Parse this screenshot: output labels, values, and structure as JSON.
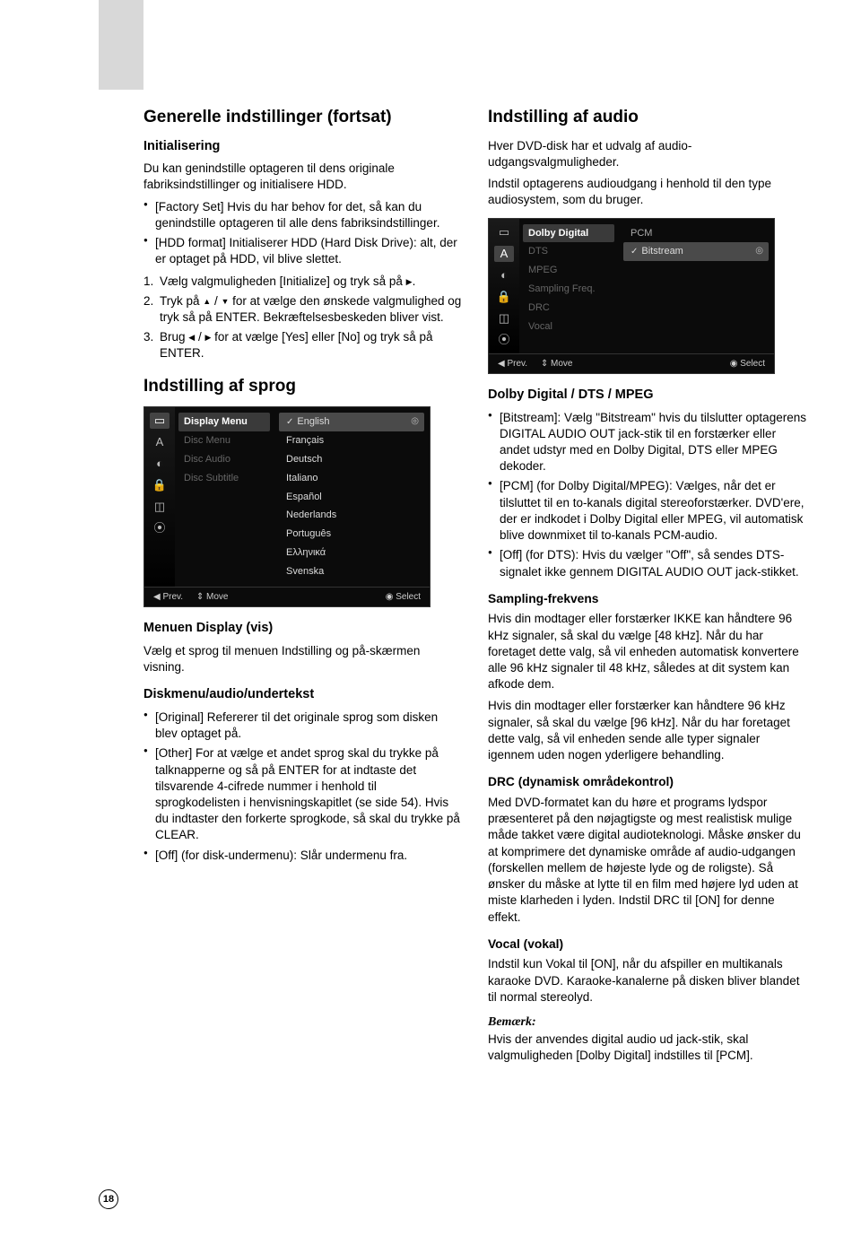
{
  "page_number": "18",
  "left": {
    "h1": "Generelle indstillinger (fortsat)",
    "init_h": "Initialisering",
    "init_p": "Du kan genindstille optageren til dens originale fabriksindstillinger og initialisere HDD.",
    "init_b1": "[Factory Set] Hvis du har behov for det, så kan du genindstille optageren til alle dens fabriksindstillinger.",
    "init_b2": "[HDD format] Initialiserer HDD (Hard Disk Drive): alt, der er optaget på HDD, vil blive slettet.",
    "s1_pre": "Vælg valgmuligheden [Initialize] og tryk så på ",
    "s2_pre": "Tryk på ",
    "s2_mid": " / ",
    "s2_post": " for at vælge den ønskede valgmulighed og tryk så på ENTER. Bekræftelsesbeskeden bliver vist.",
    "s3_pre": "Brug ",
    "s3_mid": " / ",
    "s3_post": " for at vælge [Yes] eller [No] og tryk så på ENTER.",
    "sprog_h1": "Indstilling af sprog",
    "menu1": {
      "middle": [
        "Display Menu",
        "Disc Menu",
        "Disc Audio",
        "Disc Subtitle"
      ],
      "options": [
        "English",
        "Français",
        "Deutsch",
        "Italiano",
        "Español",
        "Nederlands",
        "Português",
        "Ελληνικά",
        "Svenska"
      ],
      "footer_prev": "◀ Prev.",
      "footer_move": "⇕ Move",
      "footer_select": "◉ Select"
    },
    "display_h": "Menuen Display (vis)",
    "display_p": "Vælg et sprog til menuen Indstilling og på-skærmen visning.",
    "disk_h": "Diskmenu/audio/undertekst",
    "disk_b1": "[Original] Refererer til det originale sprog som disken blev optaget på.",
    "disk_b2": "[Other] For at vælge et andet sprog skal du trykke på talknapperne og så på ENTER for at indtaste det tilsvarende 4-cifrede nummer i henhold til sprogkodelisten i henvisningskapitlet (se side 54). Hvis du indtaster den forkerte sprogkode, så skal du trykke på CLEAR.",
    "disk_b3": "[Off] (for disk-undermenu): Slår undermenu fra."
  },
  "right": {
    "h1": "Indstilling af audio",
    "p1": "Hver DVD-disk har et udvalg af audio-udgangsvalgmuligheder.",
    "p2": "Indstil optagerens audioudgang i henhold til den type audiosystem, som du bruger.",
    "menu2": {
      "middle": [
        "Dolby Digital",
        "DTS",
        "MPEG",
        "Sampling Freq.",
        "DRC",
        "Vocal"
      ],
      "right_label": "PCM",
      "right_sel": "Bitstream",
      "footer_prev": "◀ Prev.",
      "footer_move": "⇕ Move",
      "footer_select": "◉ Select"
    },
    "dolby_h": "Dolby Digital / DTS / MPEG",
    "dolby_b1": "[Bitstream]: Vælg \"Bitstream\" hvis du tilslutter optagerens DIGITAL AUDIO OUT jack-stik til en forstærker eller andet udstyr med en Dolby Digital, DTS eller MPEG dekoder.",
    "dolby_b2": "[PCM] (for Dolby Digital/MPEG): Vælges, når det er tilsluttet til en to-kanals digital stereoforstærker. DVD'ere, der er indkodet i Dolby Digital eller MPEG, vil automatisk blive downmixet til to-kanals PCM-audio.",
    "dolby_b3": "[Off] (for DTS): Hvis du vælger \"Off\", så sendes DTS-signalet ikke gennem DIGITAL AUDIO OUT jack-stikket.",
    "samp_h": "Sampling-frekvens",
    "samp_p1": "Hvis din modtager eller forstærker IKKE kan håndtere 96 kHz signaler, så skal du vælge [48 kHz]. Når du har foretaget dette valg, så vil enheden automatisk konvertere alle 96 kHz signaler til 48 kHz, således at dit system kan afkode dem.",
    "samp_p2": "Hvis din modtager eller forstærker kan håndtere 96 kHz signaler, så skal du vælge [96 kHz]. Når du har foretaget dette valg, så vil enheden sende alle typer signaler igennem uden nogen yderligere behandling.",
    "drc_h": "DRC (dynamisk områdekontrol)",
    "drc_p": "Med DVD-formatet kan du høre et programs lydspor præsenteret på den nøjagtigste og mest realistisk mulige måde takket være digital audioteknologi. Måske ønsker du at komprimere det dynamiske område af audio-udgangen (forskellen mellem de højeste lyde og de roligste). Så ønsker du måske at lytte til en film med højere lyd uden at miste klarheden i lyden. Indstil DRC til [ON] for denne effekt.",
    "vocal_h": "Vocal (vokal)",
    "vocal_p": "Indstil kun Vokal til [ON], når du afspiller en multikanals karaoke DVD. Karaoke-kanalerne på disken bliver blandet til normal stereolyd.",
    "note_label": "Bemærk:",
    "note_p": "Hvis der anvendes digital audio ud jack-stik, skal valgmuligheden [Dolby Digital] indstilles til [PCM]."
  }
}
